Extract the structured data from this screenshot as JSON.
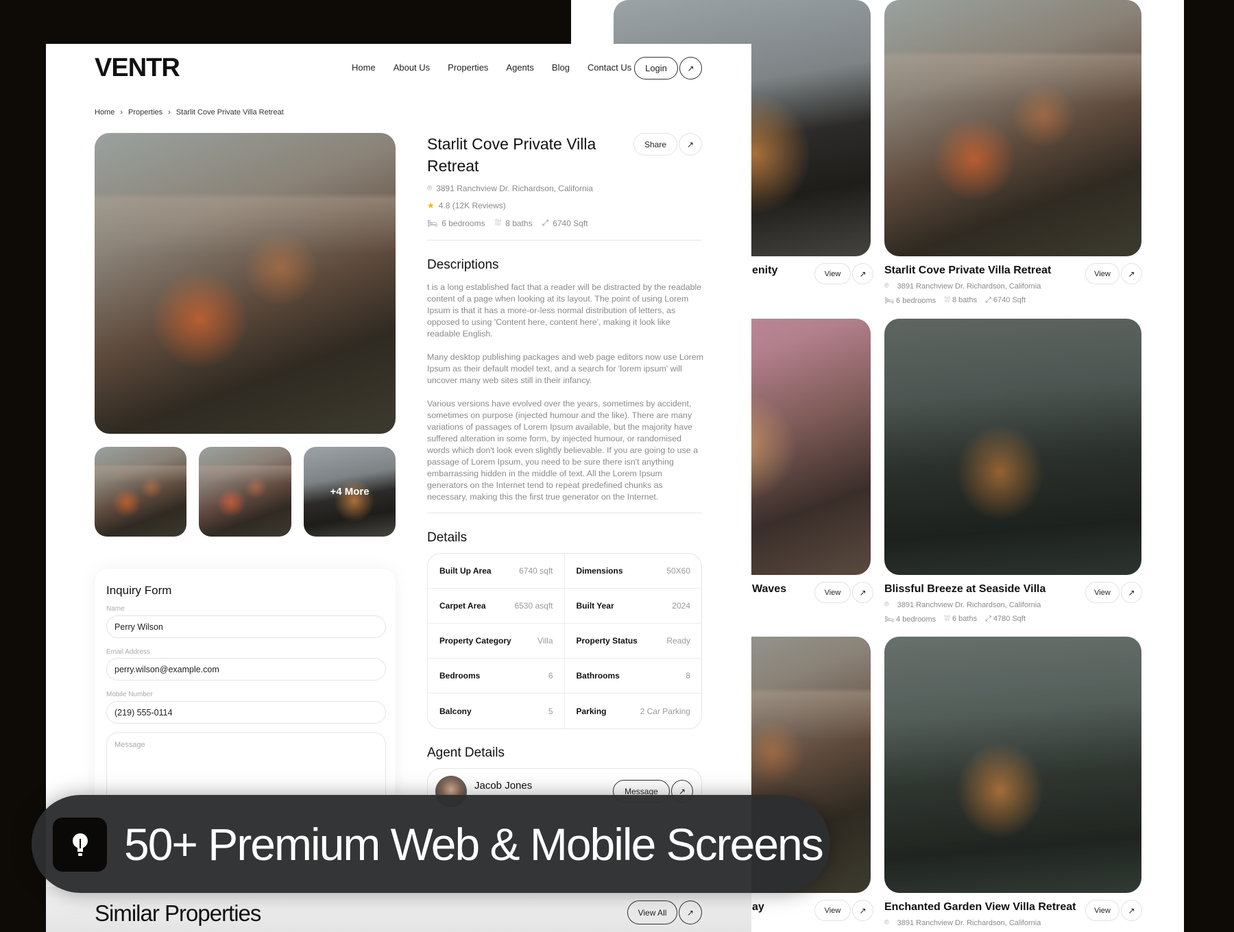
{
  "brand": {
    "logo": "VENTR"
  },
  "nav": {
    "items": [
      "Home",
      "About Us",
      "Properties",
      "Agents",
      "Blog",
      "Contact Us"
    ],
    "login": "Login",
    "arrow": "↗"
  },
  "breadcrumb": [
    "Home",
    "Properties",
    "Starlit Cove Private Villa Retreat"
  ],
  "gallery": {
    "more_label": "+4 More"
  },
  "property": {
    "title": "Starlit Cove Private Villa Retreat",
    "share": "Share",
    "address": "3891 Ranchview Dr. Richardson, California",
    "rating": "4.8 (12K Reviews)",
    "bedrooms": "6 bedrooms",
    "baths": "8 baths",
    "area": "6740 Sqft",
    "star_color": "#f5b400"
  },
  "descriptions": {
    "heading": "Descriptions",
    "paragraphs": [
      "t is a long established fact that a reader will be distracted by the readable content of a page when looking at its layout. The point of using Lorem Ipsum is that it has a more-or-less normal distribution of letters, as opposed to using 'Content here, content here', making it look like readable English.",
      "Many desktop publishing packages and web page editors now use Lorem Ipsum as their default model text, and a search for 'lorem ipsum' will uncover many web sites still in their infancy.",
      "Various versions have evolved over the years, sometimes by accident, sometimes on purpose (injected humour and the like). There are many variations of passages of Lorem Ipsum available, but the majority have suffered alteration in some form, by injected humour, or randomised words which don't look even slightly believable. If you are going to use a passage of Lorem Ipsum, you need to be sure there isn't anything embarrassing hidden in the middle of text. All the Lorem Ipsum generators on the Internet tend to repeat predefined chunks as necessary, making this the first true generator on the Internet."
    ]
  },
  "details": {
    "heading": "Details",
    "rows": [
      {
        "key": "Built Up Area",
        "value": "6740 sqft"
      },
      {
        "key": "Dimensions",
        "value": "50X60"
      },
      {
        "key": "Carpet Area",
        "value": "6530 asqft"
      },
      {
        "key": "Built Year",
        "value": "2024"
      },
      {
        "key": "Property Category",
        "value": "Villa"
      },
      {
        "key": "Property Status",
        "value": "Ready"
      },
      {
        "key": "Bedrooms",
        "value": "6"
      },
      {
        "key": "Bathrooms",
        "value": "8"
      },
      {
        "key": "Balcony",
        "value": "5"
      },
      {
        "key": "Parking",
        "value": "2 Car Parking"
      }
    ]
  },
  "agent": {
    "heading": "Agent Details",
    "name": "Jacob Jones",
    "message": "Message"
  },
  "inquiry": {
    "title": "Inquiry Form",
    "name_label": "Name",
    "name_value": "Perry Wilson",
    "email_label": "Email Address",
    "email_value": "perry.wilson@example.com",
    "mobile_label": "Mobile Number",
    "mobile_value": "(219) 555-0114",
    "message_placeholder": "Message"
  },
  "similar": {
    "heading": "Similar Properties",
    "view_all": "View All"
  },
  "banner": {
    "text": "50+ Premium Web & Mobile Screens",
    "icon": "lightbulb-icon"
  },
  "cards_right": [
    {
      "title": "Starlit Cove Private Villa Retreat",
      "address": "3891 Ranchview Dr. Richardson, California",
      "bedrooms": "6 bedrooms",
      "baths": "8 baths",
      "area": "6740 Sqft",
      "view": "View"
    },
    {
      "title": "Blissful Breeze at Seaside Villa",
      "address": "3891 Ranchview Dr. Richardson, California",
      "bedrooms": "4 bedrooms",
      "baths": "6 baths",
      "area": "4780 Sqft",
      "view": "View"
    },
    {
      "title": "Enchanted Garden View Villa Retreat",
      "address": "3891 Ranchview Dr. Richardson, California",
      "view": "View"
    }
  ],
  "cards_left": [
    {
      "title_fragment": "enity",
      "view": "View"
    },
    {
      "title_fragment": "Waves",
      "view": "View"
    },
    {
      "title_fragment": "ay",
      "view": "View"
    }
  ]
}
